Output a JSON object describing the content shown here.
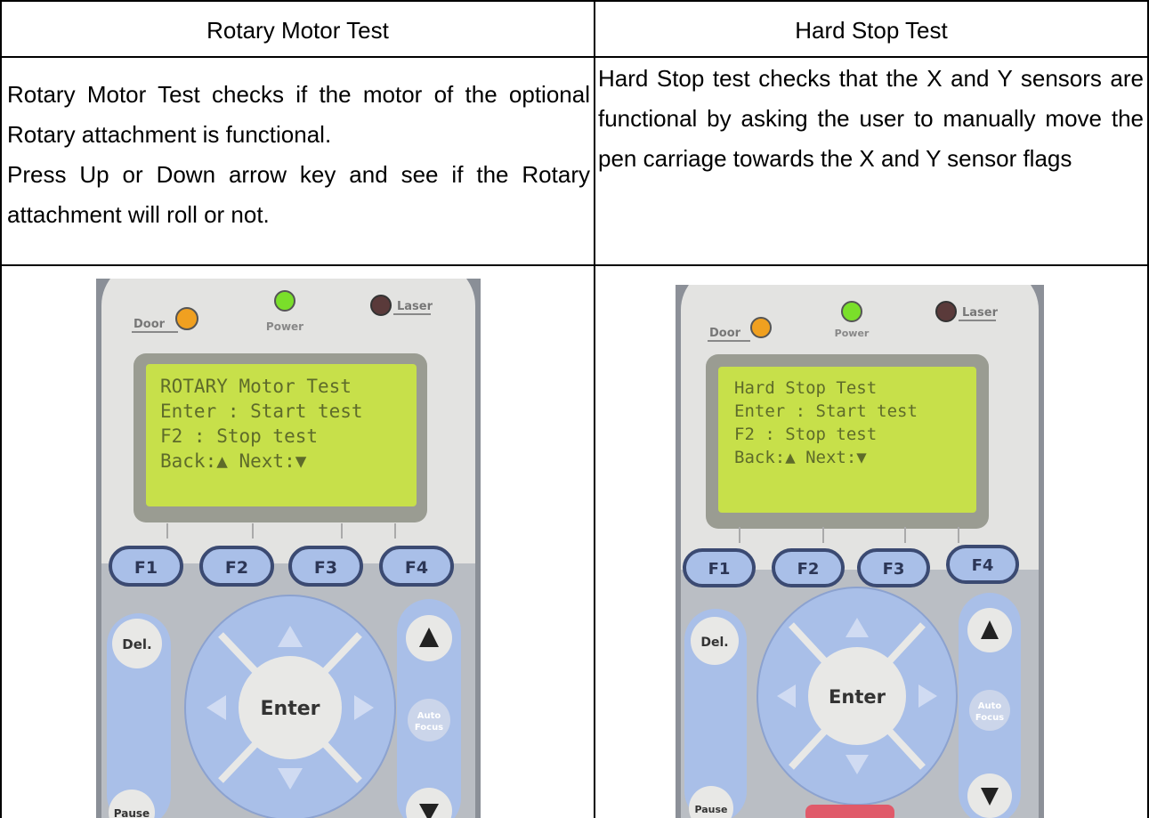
{
  "table": {
    "left": {
      "header": "Rotary Motor Test",
      "paragraphs": [
        "Rotary Motor Test checks if the motor of the optional Rotary attachment is functional.",
        "Press Up or Down arrow key and see if the Rotary attachment will roll or not."
      ],
      "photo": {
        "leds": {
          "door": "Door",
          "power": "Power",
          "laser": "Laser"
        },
        "lcd": [
          "ROTARY Motor Test",
          "Enter : Start test",
          "F2    : Stop test",
          "Back:▲   Next:▼"
        ],
        "keys": {
          "f1": "F1",
          "f2": "F2",
          "f3": "F3",
          "f4": "F4",
          "del": "Del.",
          "enter": "Enter",
          "auto": "Auto",
          "focus": "Focus",
          "pause": "Pause"
        }
      }
    },
    "right": {
      "header": "Hard Stop Test",
      "paragraphs": [
        "Hard Stop test checks that the X and Y sensors are functional by asking the user to manually move the pen carriage towards the X and Y sensor flags"
      ],
      "photo": {
        "leds": {
          "door": "Door",
          "power": "Power",
          "laser": "Laser"
        },
        "lcd": [
          "Hard Stop Test",
          "Enter : Start test",
          "F2    : Stop test",
          "Back:▲   Next:▼"
        ],
        "keys": {
          "f1": "F1",
          "f2": "F2",
          "f3": "F3",
          "f4": "F4",
          "del": "Del.",
          "enter": "Enter",
          "auto": "Auto",
          "focus": "Focus",
          "pause": "Pause"
        }
      }
    }
  },
  "colors": {
    "panel": "#dcdcdc",
    "lcd": "#c7e04a",
    "key_blue": "#a9bfe8",
    "key_dark": "#3b4a72",
    "led_orange": "#f0a020",
    "led_green": "#7adf2a"
  }
}
